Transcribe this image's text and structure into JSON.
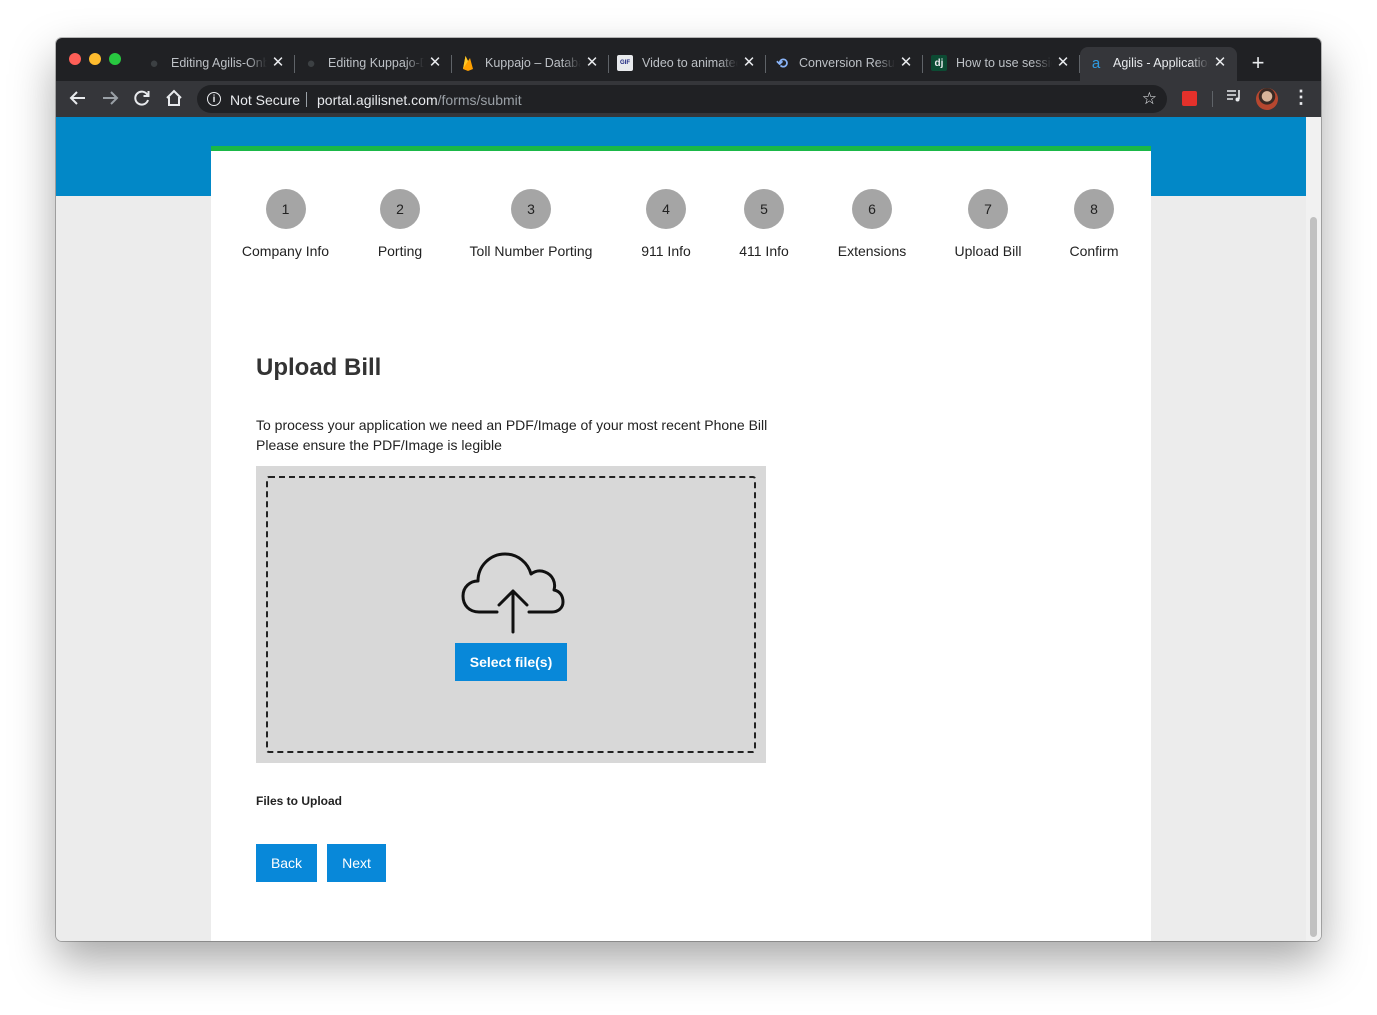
{
  "browser": {
    "tabs": [
      {
        "title": "Editing Agilis-Onboarding",
        "favicon": "github-icon"
      },
      {
        "title": "Editing Kuppajo-Database",
        "favicon": "github-icon"
      },
      {
        "title": "Kuppajo – Database",
        "favicon": "firebase-icon"
      },
      {
        "title": "Video to animated GIF",
        "favicon": "gif-icon"
      },
      {
        "title": "Conversion Results",
        "favicon": "convert-icon"
      },
      {
        "title": "How to use sessions",
        "favicon": "django-icon"
      },
      {
        "title": "Agilis - Application",
        "favicon": "agilis-icon",
        "active": true
      }
    ],
    "new_tab_label": "+",
    "security_label": "Not Secure",
    "url_host": "portal.agilisnet.com",
    "url_path": "/forms/submit",
    "favicon_glyphs": {
      "github": "●",
      "django": "dj",
      "agilis": "a",
      "convert": "⟲",
      "gif": "GIF"
    }
  },
  "steps": [
    {
      "number": "1",
      "label": "Company Info"
    },
    {
      "number": "2",
      "label": "Porting"
    },
    {
      "number": "3",
      "label": "Toll Number Porting"
    },
    {
      "number": "4",
      "label": "911 Info"
    },
    {
      "number": "5",
      "label": "411 Info"
    },
    {
      "number": "6",
      "label": "Extensions"
    },
    {
      "number": "7",
      "label": "Upload Bill"
    },
    {
      "number": "8",
      "label": "Confirm"
    }
  ],
  "page": {
    "title": "Upload Bill",
    "instruction_line1": "To process your application we need an PDF/Image of your most recent Phone Bill",
    "instruction_line2": "Please ensure the PDF/Image is legible",
    "select_button": "Select file(s)",
    "files_label": "Files to Upload",
    "back_button": "Back",
    "next_button": "Next"
  },
  "colors": {
    "brand_blue": "#0288c7",
    "button_blue": "#0888d9",
    "accent_green": "#1ab847",
    "step_gray": "#a5a5a5"
  }
}
